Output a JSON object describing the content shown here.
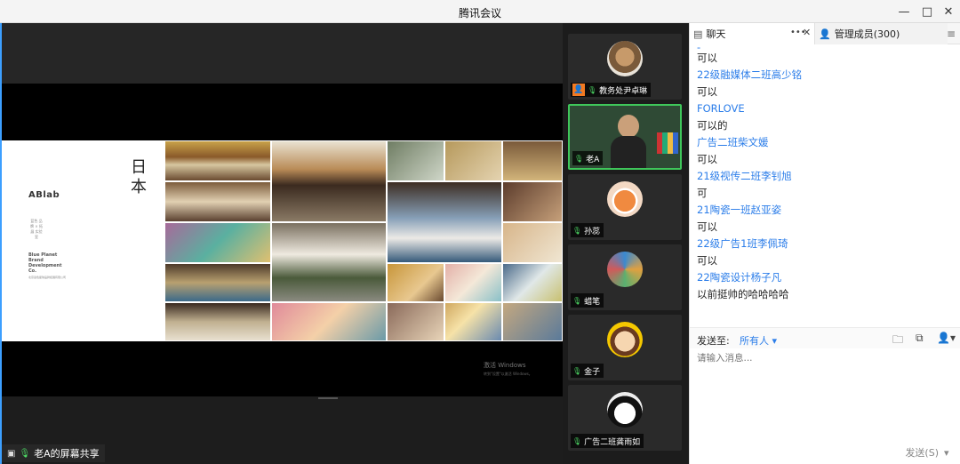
{
  "window": {
    "title": "腾讯会议"
  },
  "slide": {
    "logo": "ABlab",
    "logo_small": "蓝色 品牌 × 拓展 实验室",
    "brand": "Blue Planet Brand Development Co.",
    "brand_sub": "北京蓝色星球品牌拓展有限公司",
    "heading": "日本"
  },
  "watermark": {
    "line1": "激活 Windows",
    "line2": "转到\"设置\"以激活 Windows。"
  },
  "share": {
    "label": "老A的屏幕共享"
  },
  "participants": [
    {
      "name": "教务处尹卓琳",
      "host": true
    },
    {
      "name": "老A",
      "active": true
    },
    {
      "name": "孙蕊"
    },
    {
      "name": "蜡笔"
    },
    {
      "name": "金子"
    },
    {
      "name": "广告二班龚雨如"
    }
  ],
  "tabs": {
    "chat": "聊天",
    "members": "管理成员(300)"
  },
  "messages": [
    {
      "type": "name",
      "text": "-"
    },
    {
      "type": "text",
      "text": "可以"
    },
    {
      "type": "name",
      "text": "22级融媒体二班高少铭"
    },
    {
      "type": "text",
      "text": "可以"
    },
    {
      "type": "name",
      "text": "FORLOVE"
    },
    {
      "type": "text",
      "text": "可以的"
    },
    {
      "type": "name",
      "text": "广告二班柴文媛"
    },
    {
      "type": "text",
      "text": "可以"
    },
    {
      "type": "name",
      "text": "21级视传二班李钊旭"
    },
    {
      "type": "text",
      "text": "可"
    },
    {
      "type": "name",
      "text": "21陶瓷一班赵亚姿"
    },
    {
      "type": "text",
      "text": "可以"
    },
    {
      "type": "name",
      "text": "22级广告1班李佩琦"
    },
    {
      "type": "text",
      "text": "可以"
    },
    {
      "type": "name",
      "text": "22陶瓷设计杨子凡"
    },
    {
      "type": "text",
      "text": "以前挺帅的哈哈哈哈"
    }
  ],
  "sendbar": {
    "send_to": "发送至:",
    "recipient": "所有人 ▾"
  },
  "input": {
    "placeholder": "请输入消息..."
  },
  "send": {
    "label": "发送(S)"
  },
  "colors": {
    "accent": "#2b7de9",
    "active_border": "#3fc65a",
    "host_badge": "#f47a20"
  }
}
